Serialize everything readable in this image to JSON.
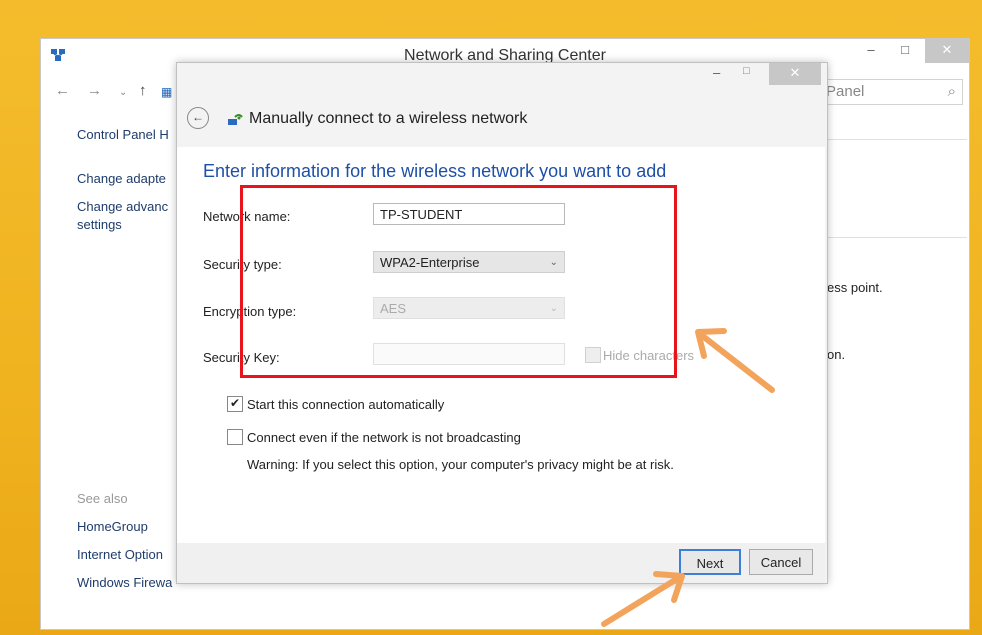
{
  "window": {
    "title": "Network and Sharing Center",
    "minimize": "–",
    "maximize": "□",
    "close": "✕"
  },
  "nav": {
    "back": "←",
    "forward": "→",
    "dropdown": "⌄",
    "up": "↑",
    "search_placeholder": "Panel",
    "search_icon": "⌕"
  },
  "sidebar": {
    "home": "Control Panel H",
    "adapter": "Change adapte",
    "advanced_line1": "Change advanc",
    "advanced_line2": "settings",
    "see_also": "See also",
    "homegroup": "HomeGroup",
    "internet_options": "Internet Option",
    "firewall": "Windows Firewa"
  },
  "background_text": {
    "line1": "ess point.",
    "line2": "on."
  },
  "dialog": {
    "minimize": "–",
    "maximize": "□",
    "close": "✕",
    "back": "←",
    "title": "Manually connect to a wireless network",
    "heading": "Enter information for the wireless network you want to add",
    "fields": {
      "network_name_label": "Network name:",
      "network_name_value": "TP-STUDENT",
      "security_type_label": "Security type:",
      "security_type_value": "WPA2-Enterprise",
      "encryption_type_label": "Encryption type:",
      "encryption_type_value": "AES",
      "security_key_label": "Security Key:",
      "security_key_value": "",
      "hide_characters": "Hide characters"
    },
    "options": {
      "start_auto": "Start this connection automatically",
      "start_auto_checked": true,
      "connect_hidden": "Connect even if the network is not broadcasting",
      "connect_hidden_checked": false,
      "warning": "Warning: If you select this option, your computer's privacy might be at risk."
    },
    "buttons": {
      "next": "Next",
      "cancel": "Cancel"
    }
  },
  "colors": {
    "highlight": "#e8141b",
    "arrow": "#f3a45c",
    "heading": "#1e4fa8"
  }
}
